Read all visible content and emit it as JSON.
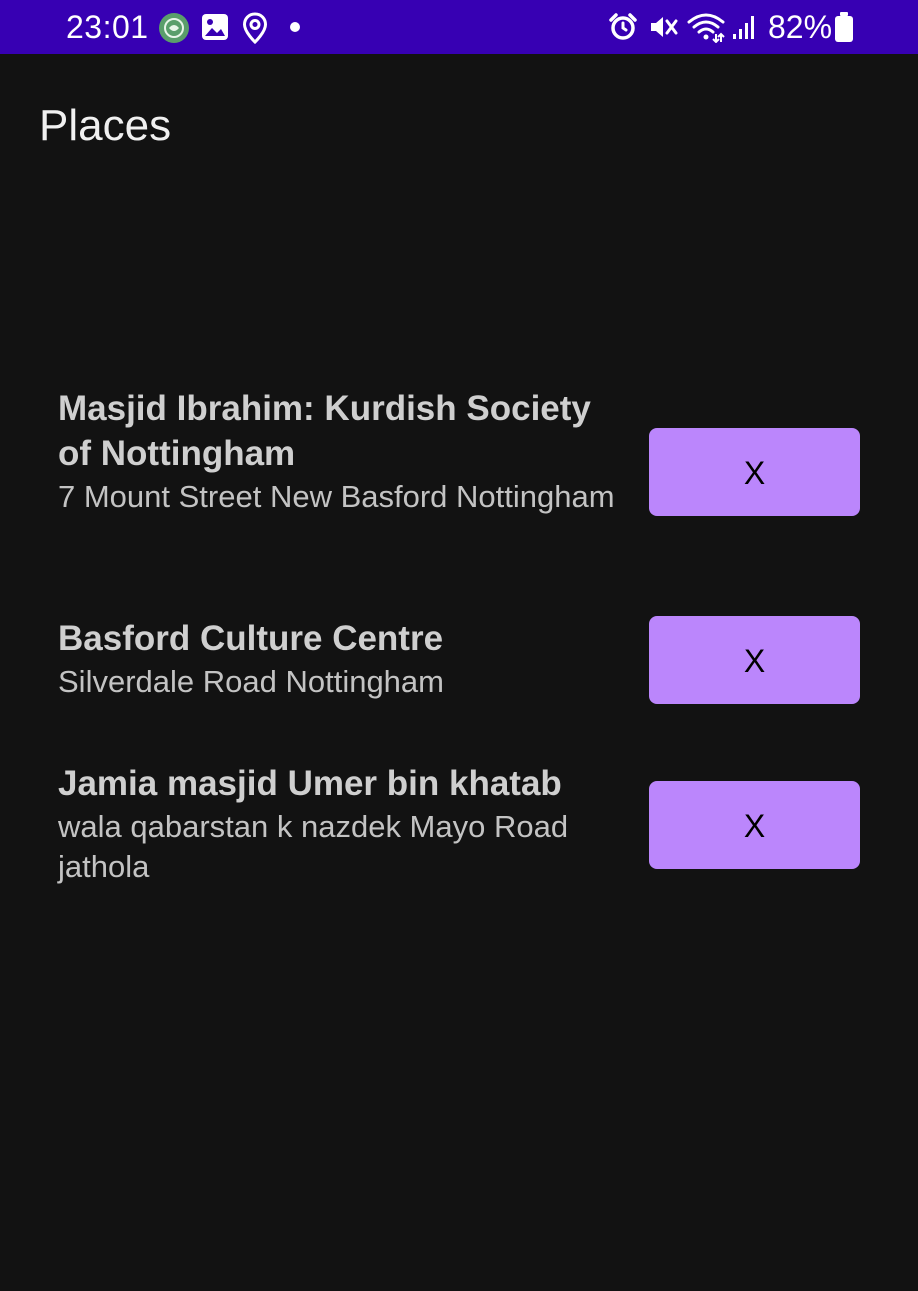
{
  "status_bar": {
    "time": "23:01",
    "battery_percent": "82%",
    "background_color": "#3700b3",
    "left_icons": [
      "quran-app-icon",
      "gallery-icon",
      "location-icon",
      "notification-dot-icon"
    ],
    "right_icons": [
      "alarm-icon",
      "vibrate-mute-icon",
      "wifi-icon",
      "signal-icon",
      "battery-icon"
    ]
  },
  "page": {
    "title": "Places"
  },
  "places": [
    {
      "name": "Masjid Ibrahim: Kurdish Society of Nottingham",
      "address": "7 Mount Street  New Basford Nottingham",
      "remove_label": "X"
    },
    {
      "name": "Basford Culture Centre",
      "address": "Silverdale Road  Nottingham",
      "remove_label": "X"
    },
    {
      "name": "Jamia masjid Umer bin khatab",
      "address": "wala qabarstan k nazdek  Mayo Road jathola",
      "remove_label": "X"
    }
  ],
  "colors": {
    "background": "#121212",
    "button": "#bb86fc",
    "button_text": "#000000"
  }
}
